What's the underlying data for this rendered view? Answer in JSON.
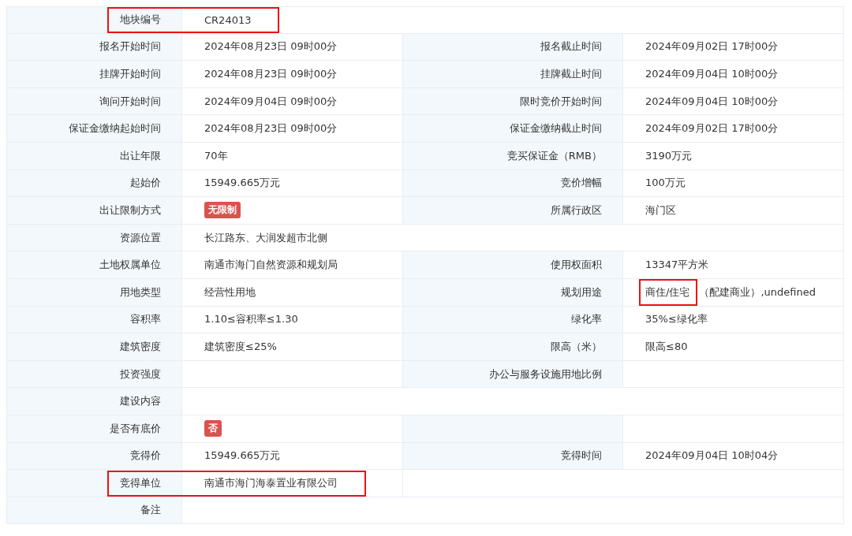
{
  "rows": [
    {
      "cells": [
        {
          "kind": "text",
          "label": "地块编号",
          "value": "CR24013",
          "highlighted": true
        }
      ]
    },
    {
      "cells": [
        {
          "kind": "text",
          "label": "报名开始时间",
          "value": "2024年08月23日 09时00分",
          "highlighted": false
        },
        {
          "kind": "text",
          "label": "报名截止时间",
          "value": "2024年09月02日 17时00分",
          "highlighted": false
        }
      ]
    },
    {
      "cells": [
        {
          "kind": "text",
          "label": "挂牌开始时间",
          "value": "2024年08月23日 09时00分",
          "highlighted": false
        },
        {
          "kind": "text",
          "label": "挂牌截止时间",
          "value": "2024年09月04日 10时00分",
          "highlighted": false
        }
      ]
    },
    {
      "cells": [
        {
          "kind": "text",
          "label": "询问开始时间",
          "value": "2024年09月04日 09时00分",
          "highlighted": false
        },
        {
          "kind": "text",
          "label": "限时竞价开始时间",
          "value": "2024年09月04日 10时00分",
          "highlighted": false
        }
      ]
    },
    {
      "cells": [
        {
          "kind": "text",
          "label": "保证金缴纳起始时间",
          "value": "2024年08月23日 09时00分",
          "highlighted": false
        },
        {
          "kind": "text",
          "label": "保证金缴纳截止时间",
          "value": "2024年09月02日 17时00分",
          "highlighted": false
        }
      ]
    },
    {
      "cells": [
        {
          "kind": "text",
          "label": "出让年限",
          "value": "70年",
          "highlighted": false
        },
        {
          "kind": "text",
          "label": "竞买保证金（RMB）",
          "value": "3190万元",
          "highlighted": false
        }
      ]
    },
    {
      "cells": [
        {
          "kind": "text",
          "label": "起始价",
          "value": "15949.665万元",
          "highlighted": false
        },
        {
          "kind": "text",
          "label": "竞价增幅",
          "value": "100万元",
          "highlighted": false
        }
      ]
    },
    {
      "cells": [
        {
          "kind": "tag",
          "label": "出让限制方式",
          "value": "无限制",
          "highlighted": false
        },
        {
          "kind": "text",
          "label": "所属行政区",
          "value": "海门区",
          "highlighted": false
        }
      ]
    },
    {
      "cells": [
        {
          "kind": "text",
          "label": "资源位置",
          "value": "长江路东、大润发超市北侧",
          "highlighted": false
        }
      ]
    },
    {
      "cells": [
        {
          "kind": "text",
          "label": "土地权属单位",
          "value": "南通市海门自然资源和规划局",
          "highlighted": false
        },
        {
          "kind": "text",
          "label": "使用权面积",
          "value": "13347平方米",
          "highlighted": false
        }
      ]
    },
    {
      "cells": [
        {
          "kind": "text",
          "label": "用地类型",
          "value": "经营性用地",
          "highlighted": false
        },
        {
          "kind": "parts",
          "label": "规划用途",
          "highlighted": false,
          "value_parts": [
            {
              "text": "商住/住宅",
              "highlighted": true
            },
            {
              "text": "（配建商业）,undefined",
              "highlighted": false
            }
          ]
        }
      ]
    },
    {
      "cells": [
        {
          "kind": "text",
          "label": "容积率",
          "value": "1.10≤容积率≤1.30",
          "highlighted": false
        },
        {
          "kind": "text",
          "label": "绿化率",
          "value": "35%≤绿化率",
          "highlighted": false
        }
      ]
    },
    {
      "cells": [
        {
          "kind": "text",
          "label": "建筑密度",
          "value": "建筑密度≤25%",
          "highlighted": false
        },
        {
          "kind": "text",
          "label": "限高（米）",
          "value": "限高≤80",
          "highlighted": false
        }
      ]
    },
    {
      "cells": [
        {
          "kind": "text",
          "label": "投资强度",
          "highlighted": false
        },
        {
          "kind": "text",
          "label": "办公与服务设施用地比例",
          "highlighted": false
        }
      ]
    },
    {
      "cells": [
        {
          "kind": "text",
          "label": "建设内容",
          "highlighted": false
        }
      ]
    },
    {
      "cells": [
        {
          "kind": "tag",
          "label": "是否有底价",
          "value": "否",
          "highlighted": false
        },
        {
          "kind": "text",
          "highlighted": false
        }
      ]
    },
    {
      "cells": [
        {
          "kind": "text",
          "label": "竞得价",
          "value": "15949.665万元",
          "highlighted": false
        },
        {
          "kind": "text",
          "label": "竞得时间",
          "value": "2024年09月04日 10时04分",
          "highlighted": false
        }
      ]
    },
    {
      "cells": [
        {
          "kind": "text",
          "label": "竞得单位",
          "value": "南通市海门海泰置业有限公司",
          "highlighted": true
        },
        {
          "kind": "blank"
        }
      ]
    },
    {
      "cells": [
        {
          "kind": "text",
          "label": "备注",
          "highlighted": false
        }
      ]
    }
  ]
}
